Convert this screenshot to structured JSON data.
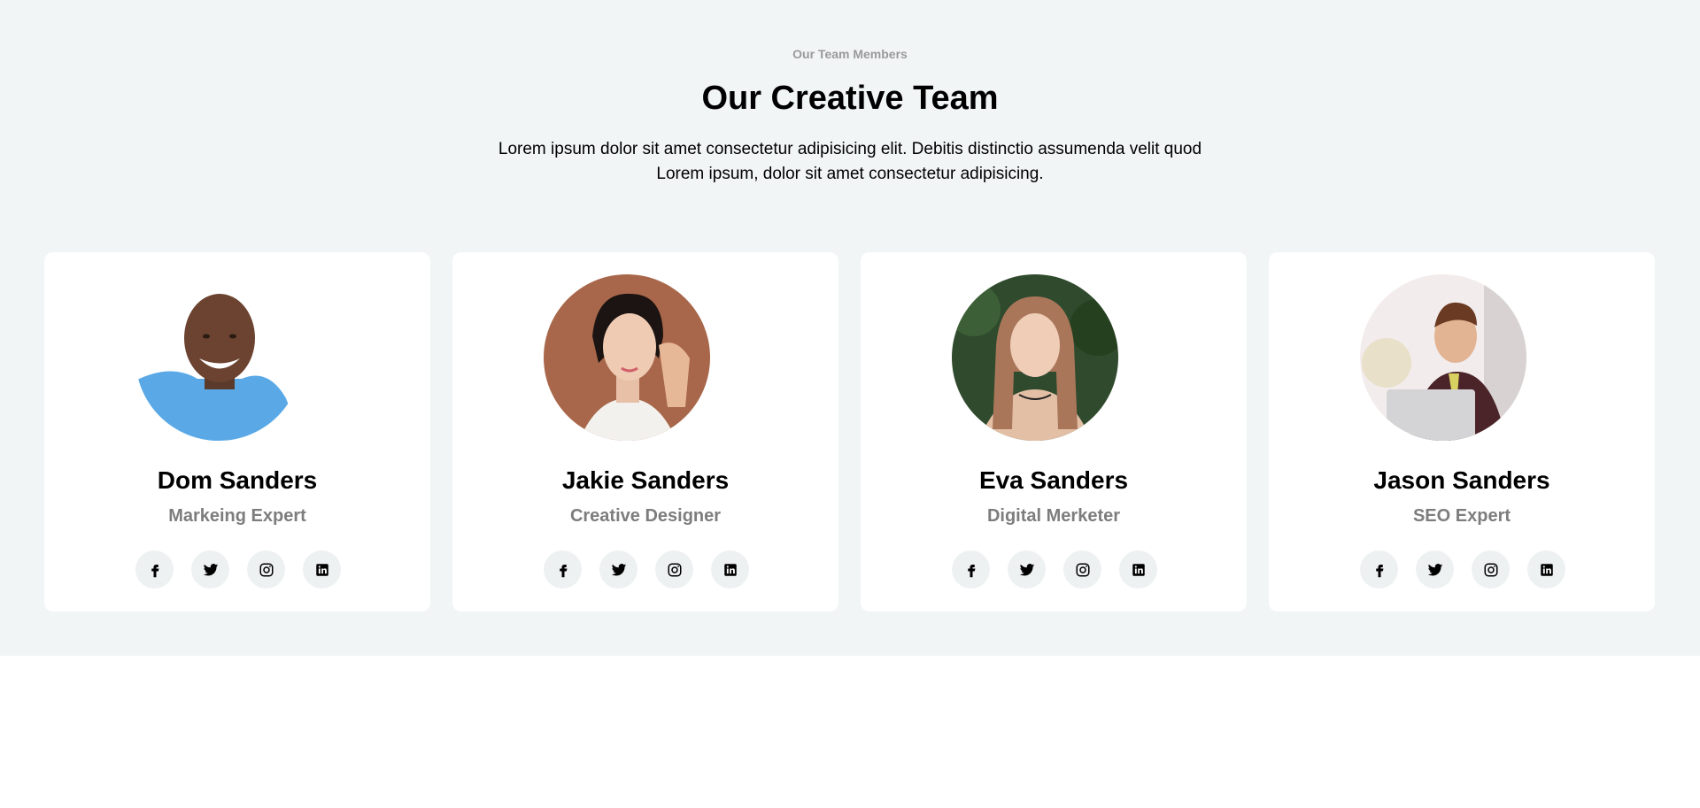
{
  "section": {
    "eyebrow": "Our Team Members",
    "title": "Our Creative Team",
    "intro_line1": "Lorem ipsum dolor sit amet consectetur adipisicing elit. Debitis distinctio assumenda velit quod",
    "intro_line2": "Lorem ipsum, dolor sit amet consectetur adipisicing."
  },
  "members": [
    {
      "name": "Dom Sanders",
      "role": "Markeing Expert"
    },
    {
      "name": "Jakie Sanders",
      "role": "Creative Designer"
    },
    {
      "name": "Eva Sanders",
      "role": "Digital Merketer"
    },
    {
      "name": "Jason Sanders",
      "role": "SEO Expert"
    }
  ],
  "social_icons": [
    "facebook-icon",
    "twitter-icon",
    "instagram-icon",
    "linkedin-icon"
  ],
  "colors": {
    "section_bg": "#f1f5f6",
    "card_bg": "#ffffff",
    "eyebrow": "#9a9a9a",
    "role_text": "#7d7d7d",
    "social_bg": "#eef1f2"
  }
}
